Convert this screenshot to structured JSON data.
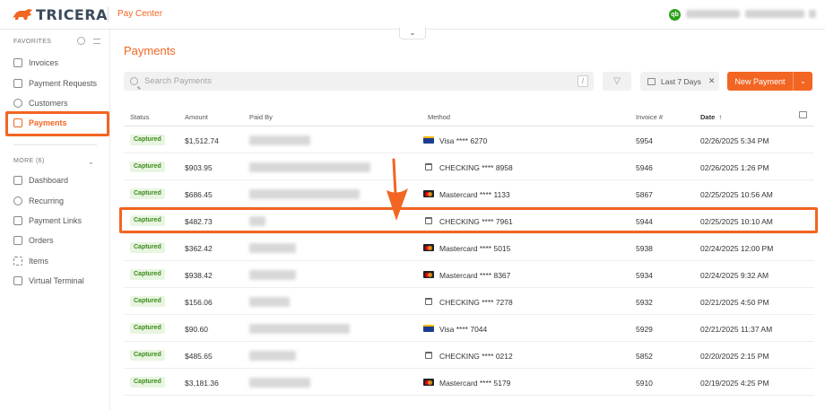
{
  "topbar": {
    "logo_text": "TRICERA",
    "app_name": "Pay Center",
    "qb_badge": "qb",
    "collapse_icon": "chevron-down-icon"
  },
  "sidebar": {
    "favorites_label": "FAVORITES",
    "favorites": [
      {
        "label": "Invoices",
        "icon": "invoice-icon"
      },
      {
        "label": "Payment Requests",
        "icon": "payment-request-icon"
      },
      {
        "label": "Customers",
        "icon": "customers-icon"
      },
      {
        "label": "Payments",
        "icon": "payments-icon",
        "active": true
      }
    ],
    "more_label": "MORE (6)",
    "more": [
      {
        "label": "Dashboard",
        "icon": "dashboard-icon"
      },
      {
        "label": "Recurring",
        "icon": "recurring-icon"
      },
      {
        "label": "Payment Links",
        "icon": "link-icon"
      },
      {
        "label": "Orders",
        "icon": "orders-icon"
      },
      {
        "label": "Items",
        "icon": "items-icon"
      },
      {
        "label": "Virtual Terminal",
        "icon": "terminal-icon"
      }
    ]
  },
  "main": {
    "title": "Payments",
    "search_placeholder": "Search Payments",
    "search_shortcut": "/",
    "date_filter": "Last 7 Days",
    "new_payment_label": "New Payment",
    "columns": {
      "status": "Status",
      "amount": "Amount",
      "paid_by": "Paid By",
      "method": "Method",
      "invoice": "Invoice #",
      "date": "Date"
    },
    "rows": [
      {
        "status": "Captured",
        "amount": "$1,512.74",
        "method_type": "visa",
        "method": "Visa **** 6270",
        "invoice": "5954",
        "date": "02/26/2025 5:34 PM"
      },
      {
        "status": "Captured",
        "amount": "$903.95",
        "method_type": "bank",
        "method": "CHECKING **** 8958",
        "invoice": "5946",
        "date": "02/26/2025 1:26 PM"
      },
      {
        "status": "Captured",
        "amount": "$686.45",
        "method_type": "mastercard",
        "method": "Mastercard **** 1133",
        "invoice": "5867",
        "date": "02/25/2025 10:56 AM"
      },
      {
        "status": "Captured",
        "amount": "$482.73",
        "method_type": "bank",
        "method": "CHECKING **** 7961",
        "invoice": "5944",
        "date": "02/25/2025 10:10 AM"
      },
      {
        "status": "Captured",
        "amount": "$362.42",
        "method_type": "mastercard",
        "method": "Mastercard **** 5015",
        "invoice": "5938",
        "date": "02/24/2025 12:00 PM"
      },
      {
        "status": "Captured",
        "amount": "$938.42",
        "method_type": "mastercard",
        "method": "Mastercard **** 8367",
        "invoice": "5934",
        "date": "02/24/2025 9:32 AM"
      },
      {
        "status": "Captured",
        "amount": "$156.06",
        "method_type": "bank",
        "method": "CHECKING **** 7278",
        "invoice": "5932",
        "date": "02/21/2025 4:50 PM"
      },
      {
        "status": "Captured",
        "amount": "$90.60",
        "method_type": "visa",
        "method": "Visa **** 7044",
        "invoice": "5929",
        "date": "02/21/2025 11:37 AM"
      },
      {
        "status": "Captured",
        "amount": "$485.65",
        "method_type": "bank",
        "method": "CHECKING **** 0212",
        "invoice": "5852",
        "date": "02/20/2025 2:15 PM"
      },
      {
        "status": "Captured",
        "amount": "$3,181.36",
        "method_type": "mastercard",
        "method": "Mastercard **** 5179",
        "invoice": "5910",
        "date": "02/19/2025 4:25 PM"
      }
    ]
  },
  "colors": {
    "accent": "#f26522",
    "captured_bg": "#e8f5e0",
    "captured_text": "#3d8b1e"
  }
}
